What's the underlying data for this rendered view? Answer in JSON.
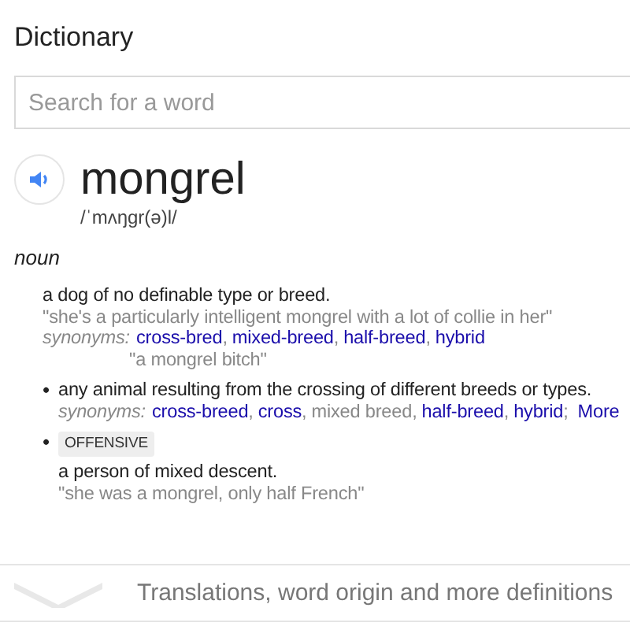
{
  "heading": "Dictionary",
  "search": {
    "placeholder": "Search for a word"
  },
  "entry": {
    "word": "mongrel",
    "pronunciation": "/ˈmʌŋɡr(ə)l/",
    "part_of_speech": "noun",
    "senses": [
      {
        "definition": "a dog of no definable type or breed.",
        "example": "\"she's a particularly intelligent mongrel with a lot of collie in her\"",
        "synonyms_label": "synonyms:",
        "synonyms": [
          {
            "text": "cross-bred",
            "kind": "link",
            "after": ","
          },
          {
            "text": "mixed-breed",
            "kind": "link",
            "after": ","
          },
          {
            "text": "half-breed",
            "kind": "link",
            "after": ","
          },
          {
            "text": "hybrid",
            "kind": "link"
          }
        ],
        "extra_example": "\"a mongrel bitch\""
      },
      {
        "bullet": "•",
        "definition": "any animal resulting from the crossing of different breeds or types.",
        "synonyms_label": "synonyms:",
        "synonyms": [
          {
            "text": "cross-breed",
            "kind": "link",
            "after": ","
          },
          {
            "text": "cross",
            "kind": "link",
            "after": ","
          },
          {
            "text": "mixed breed",
            "kind": "plain",
            "after": ","
          },
          {
            "text": "half-breed",
            "kind": "link",
            "after": ","
          },
          {
            "text": "hybrid",
            "kind": "link",
            "after": ";"
          }
        ],
        "more": "More"
      },
      {
        "bullet": "•",
        "label": "OFFENSIVE",
        "definition": "a person of mixed descent.",
        "example": "\"she was a mongrel, only half French\""
      }
    ]
  },
  "more_definitions": {
    "label": "Translations, word origin and more definitions",
    "expanded": false
  }
}
